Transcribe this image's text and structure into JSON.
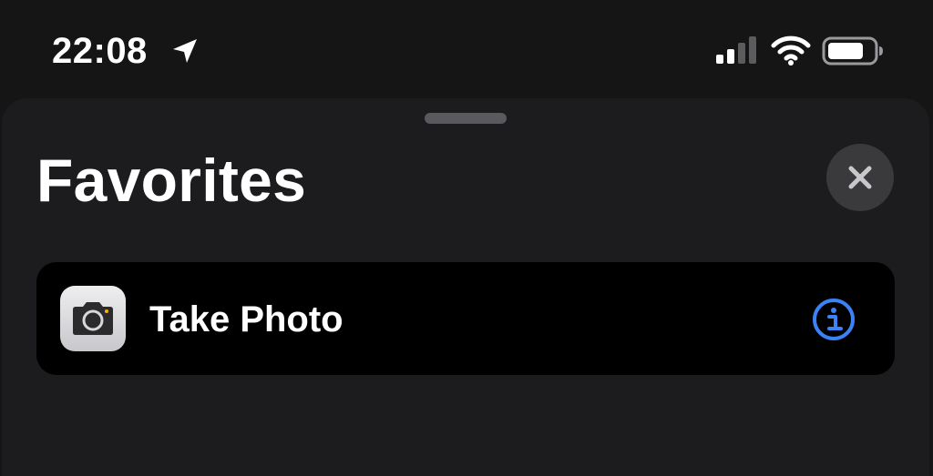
{
  "status_bar": {
    "time": "22:08",
    "icons": [
      "location-arrow-icon",
      "cellular-signal-icon",
      "wifi-icon",
      "battery-icon"
    ]
  },
  "sheet": {
    "title": "Favorites",
    "close_icon": "close-icon",
    "items": [
      {
        "label": "Take Photo",
        "icon": "camera-icon",
        "accessory_icon": "info-icon"
      }
    ]
  },
  "colors": {
    "background": "#151515",
    "sheet": "#1c1c1e",
    "card": "#000000",
    "accent": "#3b82f6",
    "close_button_bg": "#3a3a3c",
    "grabber": "#5a5a5e"
  }
}
